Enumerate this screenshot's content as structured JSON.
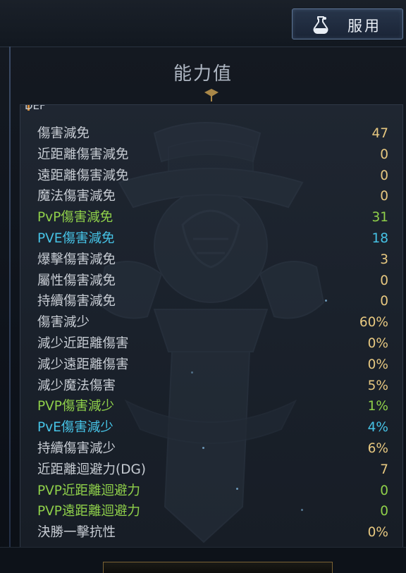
{
  "header": {
    "use_button_label": "服用",
    "use_button_icon": "potion-icon"
  },
  "section": {
    "title": "能力值",
    "cut_header": "DEF"
  },
  "colors": {
    "normal_text": "#c7ccd3",
    "value_gold": "#e7c880",
    "pvp_green": "#8fd04a",
    "pve_cyan": "#46c3e6"
  },
  "stats": [
    {
      "label": "傷害減免",
      "value": "47",
      "style": "gold"
    },
    {
      "label": "近距離傷害減免",
      "value": "0",
      "style": "normal"
    },
    {
      "label": "遠距離傷害減免",
      "value": "0",
      "style": "normal"
    },
    {
      "label": "魔法傷害減免",
      "value": "0",
      "style": "normal"
    },
    {
      "label": "PvP傷害減免",
      "value": "31",
      "style": "green"
    },
    {
      "label": "PVE傷害減免",
      "value": "18",
      "style": "cyan"
    },
    {
      "label": "爆擊傷害減免",
      "value": "3",
      "style": "normal"
    },
    {
      "label": "屬性傷害減免",
      "value": "0",
      "style": "normal"
    },
    {
      "label": "持續傷害減免",
      "value": "0",
      "style": "normal"
    },
    {
      "label": "傷害減少",
      "value": "60%",
      "style": "normal"
    },
    {
      "label": "減少近距離傷害",
      "value": "0%",
      "style": "normal"
    },
    {
      "label": "減少遠距離傷害",
      "value": "0%",
      "style": "normal"
    },
    {
      "label": "減少魔法傷害",
      "value": "5%",
      "style": "normal"
    },
    {
      "label": "PVP傷害減少",
      "value": "1%",
      "style": "green"
    },
    {
      "label": "PvE傷害減少",
      "value": "4%",
      "style": "cyan"
    },
    {
      "label": "持續傷害減少",
      "value": "6%",
      "style": "normal"
    },
    {
      "label": "近距離迴避力(DG)",
      "value": "7",
      "style": "normal"
    },
    {
      "label": "PVP近距離迴避力",
      "value": "0",
      "style": "green"
    },
    {
      "label": "PVP遠距離迴避力",
      "value": "0",
      "style": "green"
    },
    {
      "label": "決勝一擊抗性",
      "value": "0%",
      "style": "normal"
    }
  ]
}
